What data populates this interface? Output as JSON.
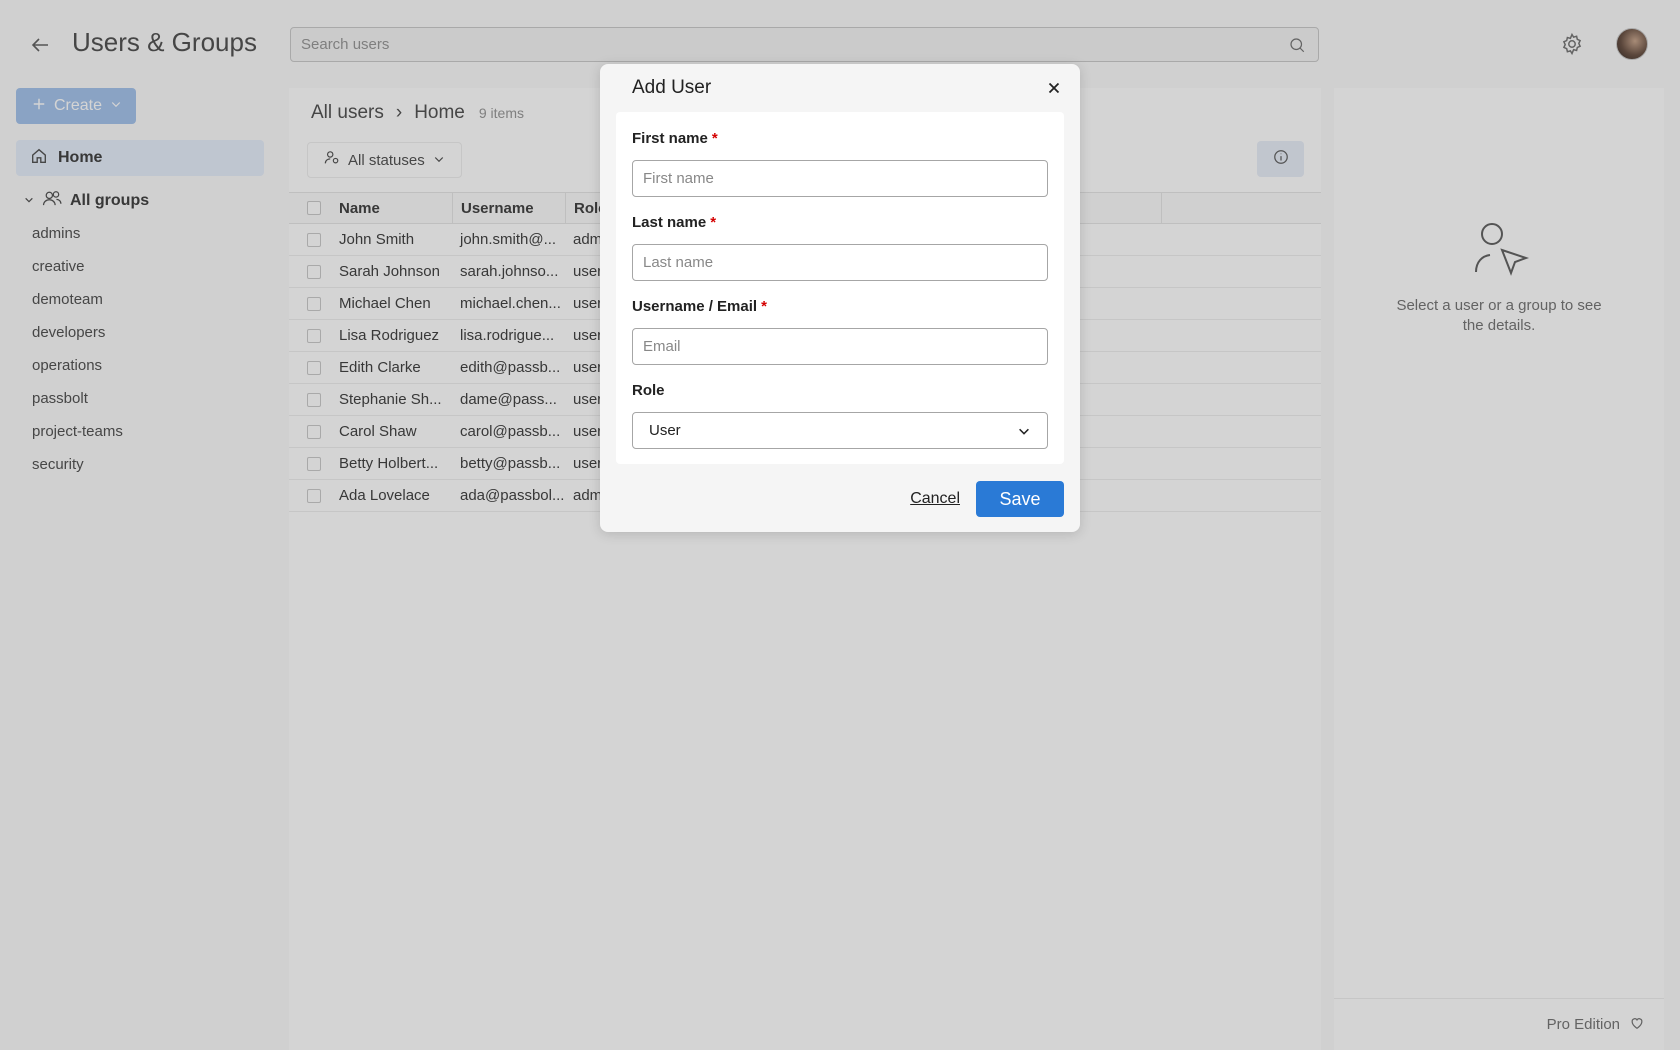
{
  "header": {
    "title": "Users & Groups",
    "search_placeholder": "Search users"
  },
  "sidebar": {
    "create_label": "Create",
    "home_label": "Home",
    "all_groups_label": "All groups",
    "groups": [
      "admins",
      "creative",
      "demoteam",
      "developers",
      "operations",
      "passbolt",
      "project-teams",
      "security"
    ]
  },
  "main": {
    "breadcrumb_root": "All users",
    "breadcrumb_separator": "›",
    "breadcrumb_current": "Home",
    "item_count": "9 items",
    "filter_label": "All statuses",
    "columns": {
      "name": "Name",
      "username": "Username",
      "role": "Role"
    },
    "rows": [
      {
        "name": "John Smith",
        "username": "john.smith@...",
        "role": "adm"
      },
      {
        "name": "Sarah Johnson",
        "username": "sarah.johnso...",
        "role": "user"
      },
      {
        "name": "Michael Chen",
        "username": "michael.chen...",
        "role": "user"
      },
      {
        "name": "Lisa Rodriguez",
        "username": "lisa.rodrigue...",
        "role": "user"
      },
      {
        "name": "Edith Clarke",
        "username": "edith@passb...",
        "role": "user"
      },
      {
        "name": "Stephanie Sh...",
        "username": "dame@pass...",
        "role": "user"
      },
      {
        "name": "Carol Shaw",
        "username": "carol@passb...",
        "role": "user"
      },
      {
        "name": "Betty Holbert...",
        "username": "betty@passb...",
        "role": "user"
      },
      {
        "name": "Ada Lovelace",
        "username": "ada@passbol...",
        "role": "adm"
      }
    ]
  },
  "details": {
    "empty_message": "Select a user or a group to see the details.",
    "edition_label": "Pro Edition"
  },
  "dialog": {
    "title": "Add User",
    "required_mark": "*",
    "first_name_label": "First name",
    "first_name_placeholder": "First name",
    "last_name_label": "Last name",
    "last_name_placeholder": "Last name",
    "username_label": "Username / Email",
    "username_placeholder": "Email",
    "role_label": "Role",
    "role_value": "User",
    "cancel_label": "Cancel",
    "save_label": "Save"
  }
}
